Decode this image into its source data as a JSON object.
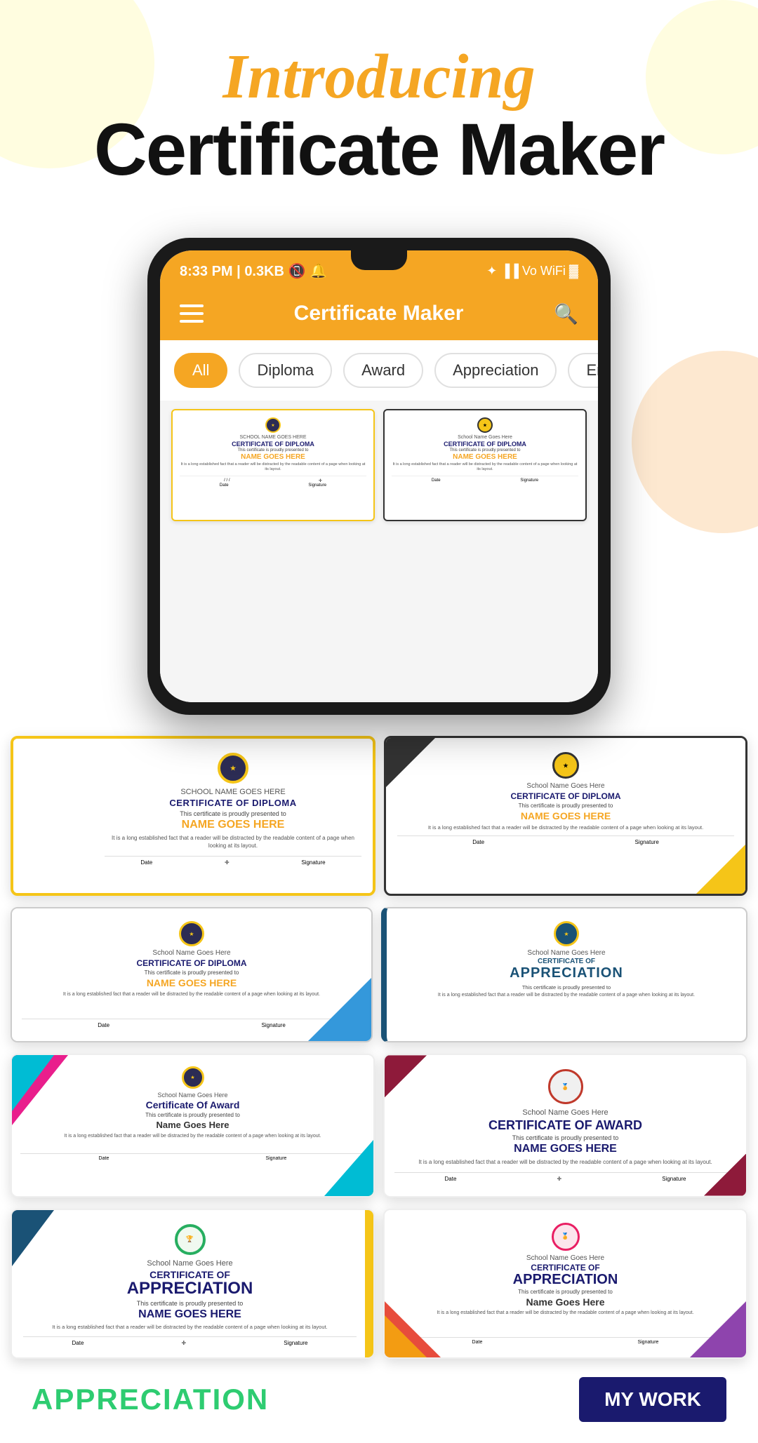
{
  "header": {
    "introducing": "Introducing",
    "app_title": "Certificate Maker"
  },
  "phone": {
    "status_bar": {
      "time": "8:33 PM",
      "data": "0.3KB",
      "battery": "🔋",
      "wifi": "WiFi"
    },
    "app_bar_title": "Certificate Maker",
    "filter_tabs": [
      "All",
      "Diploma",
      "Award",
      "Appreciation",
      "Employ of the"
    ]
  },
  "certificates": [
    {
      "id": "diploma-gold",
      "type": "Diploma",
      "school": "SCHOOL NAME GOES HERE",
      "title": "CERTIFICATE OF DIPLOMA",
      "presented_to": "This certificate is proudly presented to",
      "name": "NAME GOES HERE",
      "body": "It is a long established fact that a reader will be distracted by the readable content of a page when looking at its layout.",
      "date_label": "Date",
      "signature_label": "Signature"
    },
    {
      "id": "diploma-dark",
      "type": "Diploma",
      "school": "School Name Goes Here",
      "title": "CERTIFICATE OF DIPLOMA",
      "presented_to": "This certificate is proudly presented to",
      "name": "NAME GOES HERE",
      "body": "It is a long established fact that a reader will be distracted by the readable content of a page when looking at its layout.",
      "date_label": "Date",
      "signature_label": "Signature"
    },
    {
      "id": "appreciation-blue",
      "type": "Appreciation",
      "school": "School Name Goes Here",
      "title": "CERTIFICATE OF",
      "subtitle": "APPRECIATION",
      "presented_to": "This certificate is proudly presented to",
      "name": "NAME GOES HERE",
      "body": "It is a long established fact that a reader will be distracted by the readable content of a page when looking at its layout.",
      "date_label": "Date",
      "signature_label": "Signature"
    },
    {
      "id": "award-colorful",
      "type": "Award",
      "school": "School Name Goes Here",
      "title": "Certificate Of Award",
      "presented_to": "This certificate is proudly presented to",
      "name": "Name Goes Here",
      "body": "It is a long established fact that a reader will be distracted by the readable content of a page when looking at its layout.",
      "date_label": "Date",
      "signature_label": "Signature"
    },
    {
      "id": "award-maroon",
      "type": "Award",
      "school": "School Name Goes Here",
      "title": "CERTIFICATE OF AWARD",
      "presented_to": "This certificate is proudly presented to",
      "name": "NAME GOES HERE",
      "body": "It is a long established fact that a reader will be distracted by the readable content of a page when looking at its layout.",
      "date_label": "Date",
      "signature_label": "Signature"
    },
    {
      "id": "appreciation-blue-stripe",
      "type": "Appreciation",
      "school": "School Name Goes Here",
      "title": "CERTIFICATE OF",
      "subtitle": "APPRECIATION",
      "presented_to": "This certificate is proudly presented to",
      "name": "NAME GOES HERE",
      "body": "It is a long established fact that a reader will be distracted by the readable content of a page when looking at its layout.",
      "date_label": "Date",
      "signature_label": "Signature"
    },
    {
      "id": "appreciation-orange",
      "type": "Appreciation",
      "school": "School Name Goes Here",
      "title": "CERTIFICATE OF",
      "subtitle": "APPRECIATION",
      "presented_to": "This certificate is proudly presented to",
      "name": "Name Goes Here",
      "body": "It is a long established fact that a reader will be distracted by the readable content of a page when looking at its layout.",
      "date_label": "Date",
      "signature_label": "Signature"
    }
  ],
  "bottom_labels": {
    "appreciation": "APPRECIATION",
    "my_work": "MY WORK"
  },
  "colors": {
    "gold": "#f5a623",
    "dark_blue": "#1a1a6e",
    "maroon": "#8e1a3a",
    "teal": "#16a085",
    "blue": "#1a5276",
    "green": "#27ae60"
  }
}
